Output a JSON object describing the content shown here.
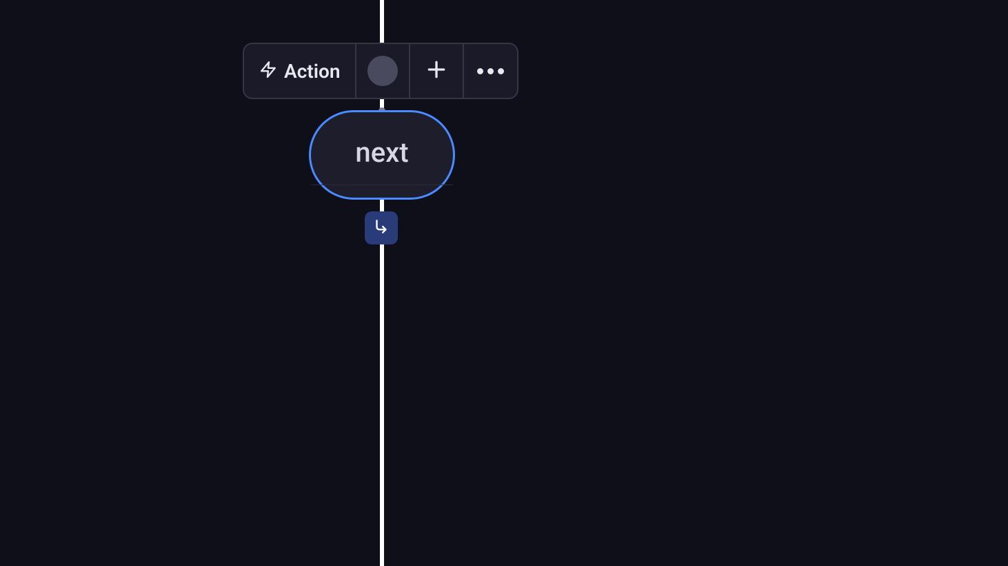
{
  "toolbar": {
    "action_label": "Action"
  },
  "node": {
    "label": "next"
  },
  "icons": {
    "lightning": "lightning-icon",
    "circle": "circle-icon",
    "plus": "plus-icon",
    "more": "more-icon",
    "arrow_down_right": "arrow-down-right-icon"
  },
  "colors": {
    "background": "#0f0f1a",
    "toolbar_bg": "#1a1a28",
    "toolbar_border": "#353545",
    "node_bg": "#1d1d2b",
    "node_border": "#4a8cff",
    "connector_bg": "#2a3b7a",
    "text_primary": "#e8e8f0",
    "text_node": "#d8d8e5",
    "line": "#ffffff"
  }
}
